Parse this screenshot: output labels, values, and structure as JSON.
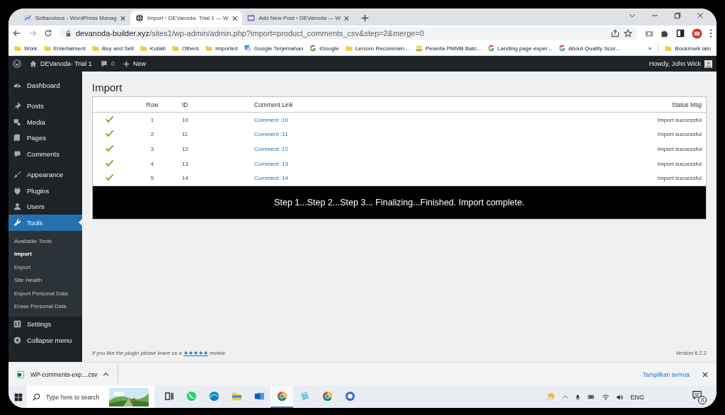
{
  "browser": {
    "tabs": [
      {
        "title": "Softaculous - WordPress Manag",
        "kind": "chart",
        "selected": false
      },
      {
        "title": "Import ‹ DEVanoda- Trial 1 — W",
        "kind": "globe",
        "selected": true
      },
      {
        "title": "Add New Post ‹ DEVanoda — W",
        "kind": "page",
        "selected": false
      }
    ],
    "address": {
      "host": "devanoda-builder.xyz",
      "path": "/sites1/wp-admin/admin.php?import=product_comments_csv&step=2&merge=0"
    },
    "bookmarks": [
      {
        "label": "Work",
        "kind": "folder"
      },
      {
        "label": "Entertaiment",
        "kind": "folder"
      },
      {
        "label": "Buy and Sell",
        "kind": "folder"
      },
      {
        "label": "Kuliah",
        "kind": "folder"
      },
      {
        "label": "Others",
        "kind": "folder"
      },
      {
        "label": "Imported",
        "kind": "folder"
      },
      {
        "label": "Google Terjemahan",
        "kind": "translate"
      },
      {
        "label": "iGoogle",
        "kind": "google"
      },
      {
        "label": "Lenovo Recommen...",
        "kind": "folder"
      },
      {
        "label": "Peserta PMMB Batc...",
        "kind": "people"
      },
      {
        "label": "Landing page exper...",
        "kind": "google"
      },
      {
        "label": "About Quality Scor...",
        "kind": "google"
      }
    ],
    "overflow": "»",
    "other_bookmarks": "Bookmark lain"
  },
  "admin_bar": {
    "site": "DEVanoda- Trial 1",
    "comments": "0",
    "new": "New",
    "greeting": "Howdy, John Wick"
  },
  "sidebar": {
    "groups": [
      [
        {
          "label": "Dashboard",
          "kind": "gauge",
          "selected": false
        }
      ],
      [
        {
          "label": "Posts",
          "kind": "pin",
          "selected": false
        },
        {
          "label": "Media",
          "kind": "media",
          "selected": false
        },
        {
          "label": "Pages",
          "kind": "pages",
          "selected": false
        },
        {
          "label": "Comments",
          "kind": "bubble",
          "selected": false
        }
      ],
      [
        {
          "label": "Appearance",
          "kind": "brush",
          "selected": false
        },
        {
          "label": "Plugins",
          "kind": "plug",
          "selected": false
        },
        {
          "label": "Users",
          "kind": "user",
          "selected": false
        },
        {
          "label": "Tools",
          "kind": "wrench",
          "selected": true,
          "children": [
            {
              "label": "Available Tools",
              "selected": false
            },
            {
              "label": "Import",
              "selected": true
            },
            {
              "label": "Export",
              "selected": false
            },
            {
              "label": "Site Health",
              "selected": false
            },
            {
              "label": "Export Personal Data",
              "selected": false
            },
            {
              "label": "Erase Personal Data",
              "selected": false
            }
          ]
        },
        {
          "label": "Settings",
          "kind": "sliders",
          "selected": false
        },
        {
          "label": "Collapse menu",
          "kind": "collapse",
          "selected": false
        }
      ]
    ]
  },
  "page": {
    "title": "Import",
    "table": {
      "columns": [
        "Row",
        "ID",
        "Comment Link",
        "Status Msg"
      ],
      "rows": [
        {
          "success": true,
          "row": "1",
          "id": "10",
          "link": "Comment :10",
          "status": "Import successful"
        },
        {
          "success": true,
          "row": "2",
          "id": "11",
          "link": "Comment :11",
          "status": "Import successful"
        },
        {
          "success": true,
          "row": "3",
          "id": "12",
          "link": "Comment :12",
          "status": "Import successful"
        },
        {
          "success": true,
          "row": "4",
          "id": "13",
          "link": "Comment :13",
          "status": "Import successful"
        },
        {
          "success": true,
          "row": "5",
          "id": "14",
          "link": "Comment :14",
          "status": "Import successful"
        }
      ]
    },
    "progress": "Step 1...Step 2...Step 3... Finalizing...Finished. Import complete.",
    "footer": {
      "before": "If you like the plugin please leave us a",
      "link": "★★★★★",
      "after": "review."
    },
    "version": "Version 6.2.2"
  },
  "downloads": {
    "file": "WP-comments-exp....csv",
    "show_all": "Tampilkan semua"
  },
  "taskbar": {
    "search_placeholder": "Type here to search",
    "apps": [
      {
        "kind": "taskview",
        "selected": false
      },
      {
        "kind": "chat",
        "selected": false
      },
      {
        "kind": "wave",
        "selected": false
      },
      {
        "kind": "folder",
        "selected": false
      },
      {
        "kind": "mail",
        "selected": false
      },
      {
        "kind": "ring",
        "selected": true
      },
      {
        "kind": "notes",
        "selected": false
      },
      {
        "kind": "ring",
        "selected": false
      },
      {
        "kind": "disc",
        "selected": false
      }
    ],
    "language": "ENG",
    "notifications": "3"
  }
}
